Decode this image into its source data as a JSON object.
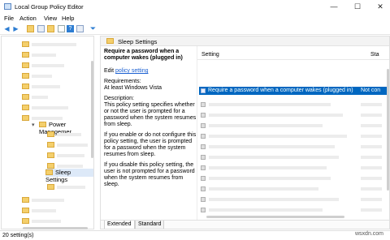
{
  "window": {
    "title": "Local Group Policy Editor",
    "minimize_glyph": "—",
    "maximize_glyph": "☐",
    "close_glyph": "✕"
  },
  "menu": [
    "File",
    "Action",
    "View",
    "Help"
  ],
  "toolbar_icons": [
    "back-arrow-icon",
    "forward-arrow-icon",
    "folder-up-icon",
    "show-hide-tree-icon",
    "export-list-icon",
    "refresh-icon",
    "help-icon",
    "properties-icon",
    "filter-icon"
  ],
  "tree": {
    "power_management": "Power Managemer",
    "sleep_settings": "Sleep Settings",
    "expander": "▾"
  },
  "panel": {
    "header_title": "Sleep Settings",
    "setting_title": "Require a password when a computer wakes (plugged in)",
    "edit_prefix": "Edit",
    "edit_link": "policy setting",
    "requirements_label": "Requirements:",
    "requirements_value": "At least Windows Vista",
    "description_label": "Description:",
    "description_1": "This policy setting specifies whether or not the user is prompted for a password when the system resumes from sleep.",
    "description_2": "If you enable or do not configure this policy setting, the user is prompted for a password when the system resumes from sleep.",
    "description_3": "If you disable this policy setting, the user is not prompted for a password when the system resumes from sleep."
  },
  "list": {
    "col_setting": "Setting",
    "col_state": "Sta",
    "selected_name": "Require a password when a computer wakes (plugged in)",
    "selected_state": "Not con"
  },
  "tabs": [
    "Extended",
    "Standard"
  ],
  "status": "20 setting(s)",
  "watermark": "wsxdn.com"
}
